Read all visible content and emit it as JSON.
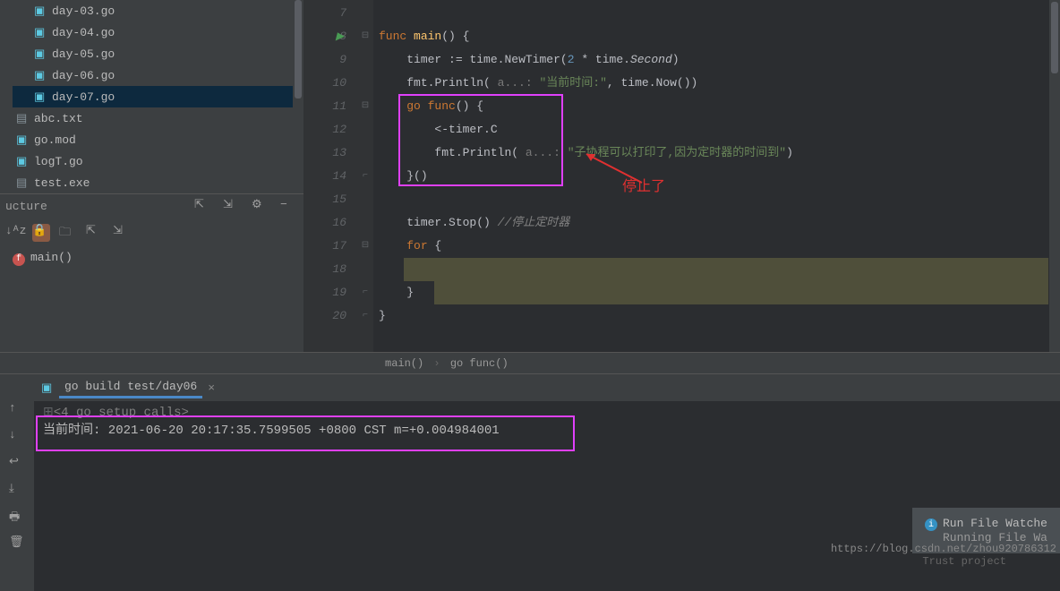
{
  "sidebar": {
    "files": [
      {
        "name": "day-03.go",
        "icon": "go"
      },
      {
        "name": "day-04.go",
        "icon": "go"
      },
      {
        "name": "day-05.go",
        "icon": "go"
      },
      {
        "name": "day-06.go",
        "icon": "go"
      },
      {
        "name": "day-07.go",
        "icon": "go",
        "selected": true
      },
      {
        "name": "abc.txt",
        "icon": "txt"
      },
      {
        "name": "go.mod",
        "icon": "go"
      },
      {
        "name": "logT.go",
        "icon": "go"
      },
      {
        "name": "test.exe",
        "icon": "txt"
      }
    ],
    "structure_label": "ucture",
    "function_name": "main()"
  },
  "editor": {
    "lines": [
      7,
      8,
      9,
      10,
      11,
      12,
      13,
      14,
      15,
      16,
      17,
      18,
      19,
      20
    ],
    "breadcrumb": {
      "a": "main()",
      "b": "go func()"
    },
    "annotation": "停止了",
    "code": {
      "l8": {
        "kw1": "func",
        "fn": "main",
        "br": "() {"
      },
      "l9": {
        "id": "timer",
        "op": " := ",
        "pkg": "time.",
        "m": "NewTimer",
        "arg1": "(",
        "num": "2",
        "op2": " * ",
        "pkg2": "time.",
        "ital": "Second",
        "close": ")"
      },
      "l10": {
        "pkg": "fmt.",
        "fn": "Println",
        "open": "( ",
        "hint": "a...:",
        "sp": " ",
        "str": "\"当前时间:\"",
        "sep": ", ",
        "pkg2": "time.",
        "m2": "Now",
        "close": "())"
      },
      "l11": {
        "kw": "go",
        "kw2": " func",
        "rest": "() {"
      },
      "l12": {
        "txt": "<-timer.C"
      },
      "l13": {
        "pkg": "fmt.",
        "fn": "Println",
        "open": "( ",
        "hint": "a...:",
        "sp": " ",
        "str": "\"子协程可以打印了,因为定时器的时间到\"",
        "close": ")"
      },
      "l14": {
        "close": "}()"
      },
      "l16": {
        "id": "timer.",
        "m": "Stop",
        "call": "() ",
        "com": "//停止定时器"
      },
      "l17": {
        "kw": "for",
        "rest": " {"
      },
      "l19": {
        "close": "}"
      },
      "l20": {
        "close": "}"
      }
    }
  },
  "terminal": {
    "tab": "go build test/day06",
    "setup": "<4 go setup calls>",
    "output": "当前时间: 2021-06-20 20:17:35.7599505 +0800 CST m=+0.004984001"
  },
  "notification": {
    "title": "Run File Watche",
    "body": "Running File Wa"
  },
  "status": {
    "trust": "Trust project"
  },
  "watermark": "https://blog.csdn.net/zhou920786312"
}
